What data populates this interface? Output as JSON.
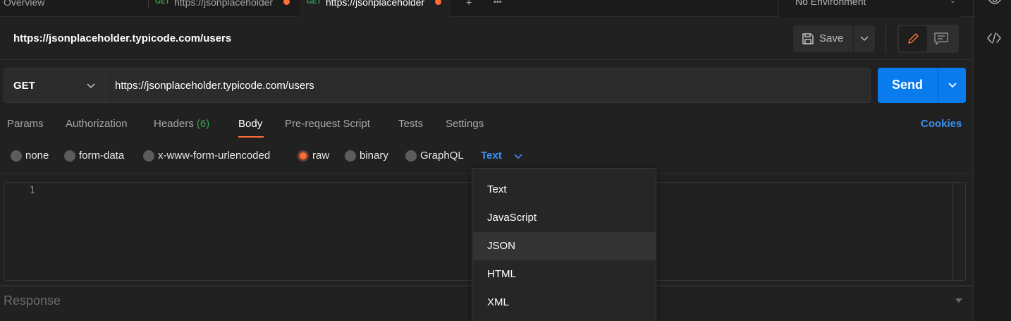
{
  "tabs": [
    {
      "label": "Overview"
    },
    {
      "method": "GET",
      "label": "https://jsonplaceholder",
      "unsaved": true
    },
    {
      "method": "GET",
      "label": "https://jsonplaceholder",
      "unsaved": true,
      "active": true
    }
  ],
  "tab_actions": {
    "add": "+",
    "more": "•••"
  },
  "environment": {
    "label": "No Environment"
  },
  "request": {
    "title": "https://jsonplaceholder.typicode.com/users",
    "method": "GET",
    "url": "https://jsonplaceholder.typicode.com/users"
  },
  "toolbar": {
    "save_label": "Save",
    "send_label": "Send"
  },
  "request_tabs": [
    {
      "label": "Params"
    },
    {
      "label": "Authorization"
    },
    {
      "label": "Headers",
      "count": "(6)"
    },
    {
      "label": "Body",
      "active": true
    },
    {
      "label": "Pre-request Script"
    },
    {
      "label": "Tests"
    },
    {
      "label": "Settings"
    }
  ],
  "cookies_label": "Cookies",
  "body_types": [
    {
      "label": "none"
    },
    {
      "label": "form-data"
    },
    {
      "label": "x-www-form-urlencoded"
    },
    {
      "label": "raw",
      "checked": true
    },
    {
      "label": "binary"
    },
    {
      "label": "GraphQL"
    }
  ],
  "raw_language": {
    "selected": "Text"
  },
  "language_menu": {
    "options": [
      "Text",
      "JavaScript",
      "JSON",
      "HTML",
      "XML"
    ],
    "highlighted": "JSON"
  },
  "editor": {
    "line_numbers": [
      "1"
    ]
  },
  "response": {
    "label": "Response"
  },
  "colors": {
    "accent_orange": "#ff6c37",
    "send_blue": "#097bed",
    "link_blue": "#3d8ff0",
    "method_green": "#37a153",
    "background": "#212121"
  },
  "icons": [
    "save-icon",
    "chevron-down-icon",
    "pencil-icon",
    "comment-icon",
    "code-icon",
    "eye-icon"
  ]
}
